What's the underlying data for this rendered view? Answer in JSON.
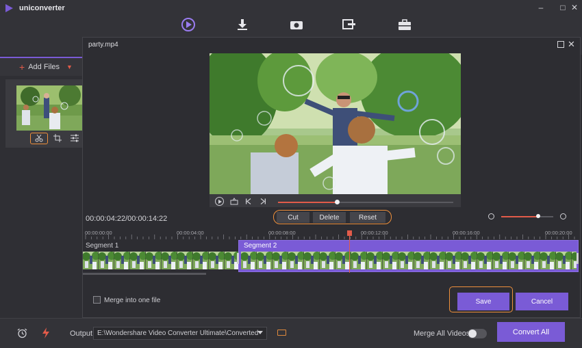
{
  "app": {
    "name": "uniconverter",
    "window_controls": [
      "–",
      "□",
      "✕"
    ],
    "nav_icons": [
      "convert-icon",
      "download-icon",
      "record-icon",
      "transfer-icon",
      "toolbox-icon"
    ]
  },
  "sidebar": {
    "add_files_label": "Add Files"
  },
  "dialog": {
    "title": "party.mp4",
    "timecode": "00:00:04:22/00:00:14:22",
    "edit_buttons": {
      "cut": "Cut",
      "delete": "Delete",
      "reset": "Reset"
    },
    "ruler_labels": [
      "00:00:00:00",
      "00:00:04:00",
      "00:00:08:00",
      "00:00:12:00",
      "00:00:16:00",
      "00:00:20:00"
    ],
    "segments": [
      {
        "label": "Segment 1"
      },
      {
        "label": "Segment 2"
      }
    ],
    "merge_into_one_file": "Merge into one file",
    "save_label": "Save",
    "cancel_label": "Cancel"
  },
  "bottom": {
    "output_label": "Output",
    "output_path": "E:\\Wondershare Video Converter Ultimate\\Converted",
    "merge_all_videos": "Merge All Videos",
    "convert_all_label": "Convert All"
  },
  "colors": {
    "accent": "#7a5bd6",
    "highlight": "#f0913c",
    "progress": "#e25b4a"
  }
}
